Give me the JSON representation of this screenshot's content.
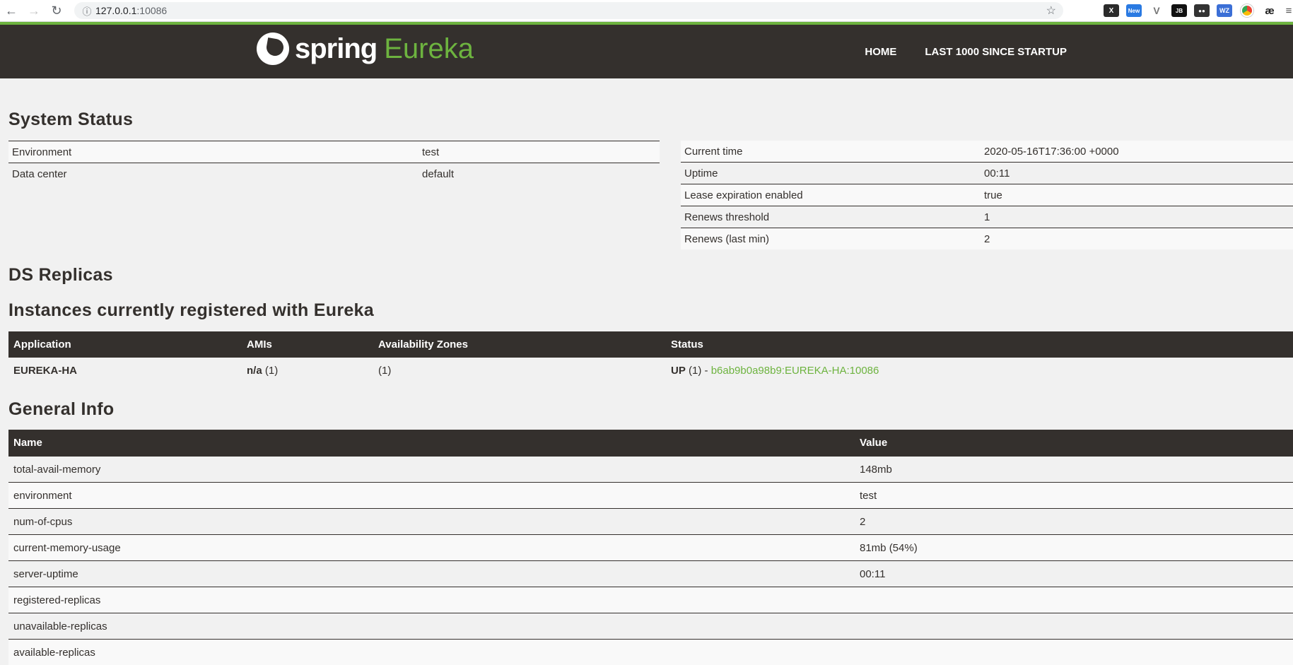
{
  "browser": {
    "url_host": "127.0.0.1",
    "url_port": ":10086",
    "extensions": [
      "x-icon",
      "new-icon",
      "v-icon",
      "jb-icon",
      "glasses-icon",
      "wz-icon",
      "chrome-icon",
      "ae-icon",
      "menu-icon"
    ],
    "ext_labels": {
      "x": "X",
      "new": "New",
      "v": "V",
      "jb": "JB",
      "glasses": "●●",
      "wz": "WZ",
      "ae": "æ",
      "menu": "≡"
    }
  },
  "header": {
    "brand_spring": "spring",
    "brand_eureka": "Eureka",
    "nav": {
      "home": "HOME",
      "last1000": "LAST 1000 SINCE STARTUP"
    },
    "accent_color": "#6db33f",
    "bg_color": "#34302d"
  },
  "system_status": {
    "title": "System Status",
    "left": [
      {
        "key": "Environment",
        "value": "test"
      },
      {
        "key": "Data center",
        "value": "default"
      }
    ],
    "right": [
      {
        "key": "Current time",
        "value": "2020-05-16T17:36:00 +0000"
      },
      {
        "key": "Uptime",
        "value": "00:11"
      },
      {
        "key": "Lease expiration enabled",
        "value": "true"
      },
      {
        "key": "Renews threshold",
        "value": "1"
      },
      {
        "key": "Renews (last min)",
        "value": "2"
      }
    ]
  },
  "ds_replicas": {
    "title": "DS Replicas"
  },
  "instances": {
    "title": "Instances currently registered with Eureka",
    "headers": [
      "Application",
      "AMIs",
      "Availability Zones",
      "Status"
    ],
    "rows": [
      {
        "application": "EUREKA-HA",
        "amis_bold": "n/a",
        "amis_count": " (1)",
        "zones": "(1)",
        "status_bold": "UP",
        "status_count": " (1) - ",
        "status_link": "b6ab9b0a98b9:EUREKA-HA:10086"
      }
    ]
  },
  "general_info": {
    "title": "General Info",
    "headers": [
      "Name",
      "Value"
    ],
    "rows": [
      {
        "name": "total-avail-memory",
        "value": "148mb"
      },
      {
        "name": "environment",
        "value": "test"
      },
      {
        "name": "num-of-cpus",
        "value": "2"
      },
      {
        "name": "current-memory-usage",
        "value": "81mb (54%)"
      },
      {
        "name": "server-uptime",
        "value": "00:11"
      },
      {
        "name": "registered-replicas",
        "value": ""
      },
      {
        "name": "unavailable-replicas",
        "value": ""
      },
      {
        "name": "available-replicas",
        "value": ""
      }
    ]
  }
}
